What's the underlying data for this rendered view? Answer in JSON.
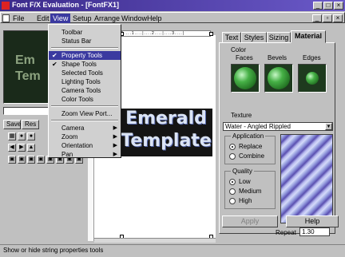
{
  "window": {
    "title": "Font F/X Evaluation - [FontFX1]"
  },
  "menubar": {
    "items": [
      "File",
      "Edit",
      "View",
      "Setup",
      "Arrange",
      "Window",
      "Help"
    ]
  },
  "view_menu": {
    "items": [
      {
        "label": "Toolbar",
        "checked": false
      },
      {
        "label": "Status Bar",
        "checked": false
      },
      {
        "label": "Property Tools",
        "checked": true,
        "highlighted": true
      },
      {
        "label": "Shape Tools",
        "checked": true
      },
      {
        "label": "Selected Tools",
        "checked": false
      },
      {
        "label": "Lighting Tools",
        "checked": false
      },
      {
        "label": "Camera Tools",
        "checked": false
      },
      {
        "label": "Color Tools",
        "checked": false
      },
      {
        "label": "Zoom View Port...",
        "checked": false
      },
      {
        "label": "Camera",
        "submenu": true
      },
      {
        "label": "Zoom",
        "submenu": true
      },
      {
        "label": "Orientation",
        "submenu": true
      },
      {
        "label": "Pan",
        "submenu": true
      }
    ]
  },
  "preview": {
    "line1": "Em",
    "line2": "Tem"
  },
  "left_panel": {
    "save_label": "Save",
    "reset_label": "Res"
  },
  "canvas": {
    "line1": "Emerald",
    "line2": "Template"
  },
  "ruler": {
    "text": "|....1....|....2....|....3....|"
  },
  "property_panel": {
    "tabs": [
      "Text",
      "Styles",
      "Sizing",
      "Material"
    ],
    "selected_tab": "Material",
    "color_label": "Color",
    "swatch_labels": [
      "Faces",
      "Bevels",
      "Edges"
    ],
    "texture_label": "Texture",
    "texture_value": "Water - Angled Rippled",
    "application": {
      "label": "Application",
      "options": [
        "Replace",
        "Combine"
      ],
      "selected": "Replace"
    },
    "quality": {
      "label": "Quality",
      "options": [
        "Low",
        "Medium",
        "High"
      ],
      "selected": "Low"
    },
    "repeat_label": "Repeat",
    "repeat_value": "1.30",
    "apply_label": "Apply",
    "help_label": "Help"
  },
  "statusbar": {
    "text": "Show or hide string properties tools"
  },
  "colors": {
    "accent": "#3b3aa0",
    "title_bar": "#3b2a8a"
  }
}
